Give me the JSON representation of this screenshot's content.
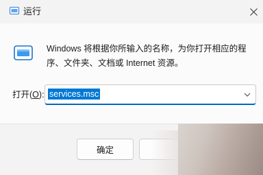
{
  "window": {
    "title": "运行",
    "close_glyph": "✕"
  },
  "dialog": {
    "description": "Windows 将根据你所输入的名称，为你打开相应的程序、文件夹、文档或 Internet 资源。",
    "open_label_prefix": "打开(",
    "open_label_key": "O",
    "open_label_suffix": "):",
    "input_value": "services.msc"
  },
  "buttons": {
    "ok_label": "确定"
  },
  "icons": {
    "app": "run-app-icon",
    "run": "run-dialog-icon",
    "close": "close-icon",
    "dropdown": "chevron-down-icon"
  },
  "colors": {
    "accent": "#0078d4",
    "selection_text": "#ffffff"
  }
}
